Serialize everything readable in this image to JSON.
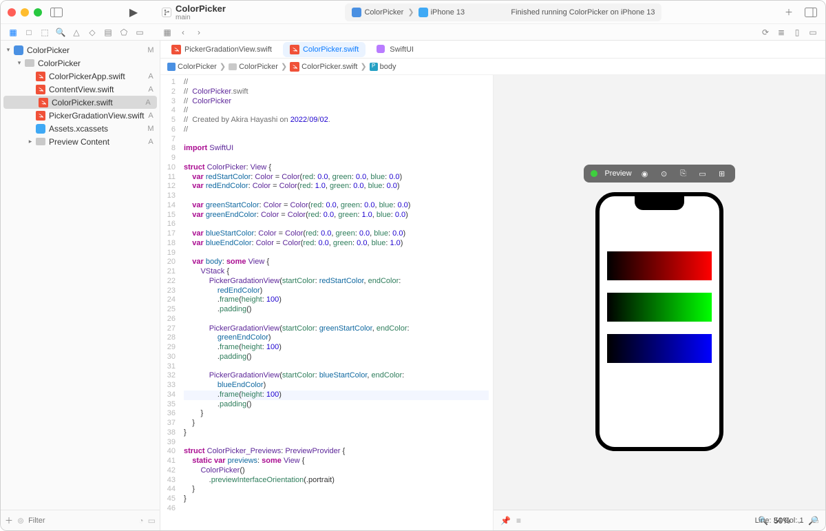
{
  "titlebar": {
    "project_name": "ColorPicker",
    "branch": "main",
    "scheme": "ColorPicker",
    "device": "iPhone 13",
    "status_message": "Finished running ColorPicker on iPhone 13"
  },
  "sidebar": {
    "filter_placeholder": "Filter",
    "tree": [
      {
        "label": "ColorPicker",
        "kind": "app",
        "indent": 0,
        "disc": "▾",
        "status": "M"
      },
      {
        "label": "ColorPicker",
        "kind": "folder",
        "indent": 1,
        "disc": "▾",
        "status": ""
      },
      {
        "label": "ColorPickerApp.swift",
        "kind": "swift",
        "indent": 2,
        "disc": "",
        "status": "A"
      },
      {
        "label": "ContentView.swift",
        "kind": "swift",
        "indent": 2,
        "disc": "",
        "status": "A"
      },
      {
        "label": "ColorPicker.swift",
        "kind": "swift",
        "indent": 2,
        "disc": "",
        "status": "A",
        "selected": true
      },
      {
        "label": "PickerGradationView.swift",
        "kind": "swift",
        "indent": 2,
        "disc": "",
        "status": "A"
      },
      {
        "label": "Assets.xcassets",
        "kind": "assets",
        "indent": 2,
        "disc": "",
        "status": "M"
      },
      {
        "label": "Preview Content",
        "kind": "folder",
        "indent": 2,
        "disc": "▸",
        "status": "A"
      }
    ]
  },
  "tabs": [
    {
      "label": "PickerGradationView.swift",
      "kind": "swift"
    },
    {
      "label": "ColorPicker.swift",
      "kind": "swift",
      "active": true
    },
    {
      "label": "SwiftUI",
      "kind": "module"
    }
  ],
  "breadcrumb": [
    {
      "label": "ColorPicker",
      "kind": "app"
    },
    {
      "label": "ColorPicker",
      "kind": "folder"
    },
    {
      "label": "ColorPicker.swift",
      "kind": "swift"
    },
    {
      "label": "body",
      "kind": "property"
    }
  ],
  "code_lines": [
    "//",
    "//  ColorPicker.swift",
    "//  ColorPicker",
    "//",
    "//  Created by Akira Hayashi on 2022/09/02.",
    "//",
    "",
    "import SwiftUI",
    "",
    "struct ColorPicker: View {",
    "    var redStartColor: Color = Color(red: 0.0, green: 0.0, blue: 0.0)",
    "    var redEndColor: Color = Color(red: 1.0, green: 0.0, blue: 0.0)",
    "",
    "    var greenStartColor: Color = Color(red: 0.0, green: 0.0, blue: 0.0)",
    "    var greenEndColor: Color = Color(red: 0.0, green: 1.0, blue: 0.0)",
    "",
    "    var blueStartColor: Color = Color(red: 0.0, green: 0.0, blue: 0.0)",
    "    var blueEndColor: Color = Color(red: 0.0, green: 0.0, blue: 1.0)",
    "",
    "    var body: some View {",
    "        VStack {",
    "            PickerGradationView(startColor: redStartColor, endColor:",
    "                redEndColor)",
    "                .frame(height: 100)",
    "                .padding()",
    "",
    "            PickerGradationView(startColor: greenStartColor, endColor:",
    "                greenEndColor)",
    "                .frame(height: 100)",
    "                .padding()",
    "",
    "            PickerGradationView(startColor: blueStartColor, endColor:",
    "                blueEndColor)",
    "                .frame(height: 100)",
    "                .padding()",
    "        }",
    "    }",
    "}",
    "",
    "struct ColorPicker_Previews: PreviewProvider {",
    "    static var previews: some View {",
    "        ColorPicker()",
    "            .previewInterfaceOrientation(.portrait)",
    "    }",
    "}",
    ""
  ],
  "code_line_numbers": [
    "1",
    "2",
    "3",
    "4",
    "5",
    "6",
    "7",
    "8",
    "9",
    "10",
    "11",
    "12",
    "13",
    "14",
    "15",
    "16",
    "17",
    "18",
    "19",
    "20",
    "21",
    "22",
    "23",
    "24",
    "25",
    "26",
    "27",
    "28",
    "29",
    "30",
    "31",
    "32",
    "33",
    "34",
    "35",
    "36",
    "37",
    "38",
    "39",
    "40",
    "41",
    "42",
    "43"
  ],
  "gutter_map": {
    "22": "22",
    "23": "23",
    "24": "24",
    "26": "26",
    "27": "27",
    "28": "28",
    "30": "30",
    "31": "31",
    "32": "32"
  },
  "current_line": 34,
  "preview": {
    "label": "Preview",
    "zoom": "50%"
  },
  "statusbar": {
    "cursor": "Line: 34  Col: 1"
  }
}
